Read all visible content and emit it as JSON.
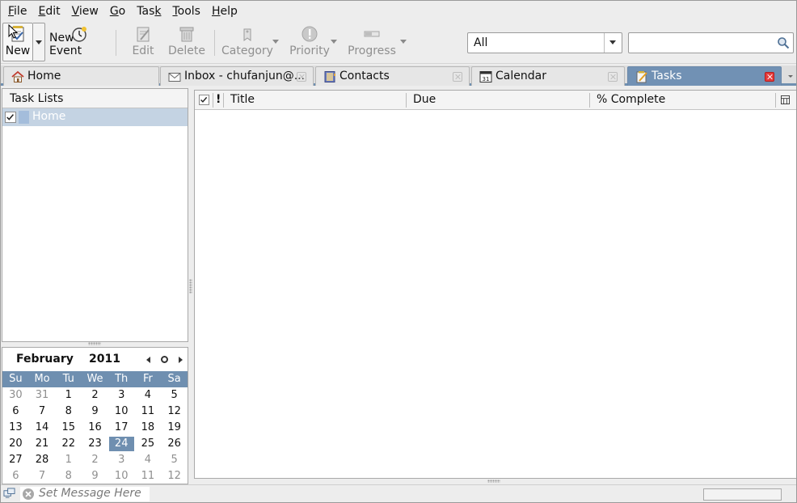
{
  "menubar": {
    "items": [
      {
        "label": "File",
        "accel": "F",
        "rest": "ile"
      },
      {
        "label": "Edit",
        "accel": "E",
        "rest": "dit"
      },
      {
        "label": "View",
        "accel": "V",
        "rest": "iew"
      },
      {
        "label": "Go",
        "accel": "G",
        "rest": "o"
      },
      {
        "label": "Task",
        "pre": "Tas",
        "accel": "k",
        "rest": ""
      },
      {
        "label": "Tools",
        "accel": "T",
        "rest": "ools"
      },
      {
        "label": "Help",
        "accel": "H",
        "rest": "elp"
      }
    ]
  },
  "toolbar": {
    "new_label": "New",
    "new_event_label": "New Event",
    "edit_label": "Edit",
    "delete_label": "Delete",
    "category_label": "Category",
    "priority_label": "Priority",
    "progress_label": "Progress",
    "filter_value": "All",
    "search_value": ""
  },
  "tabs": [
    {
      "label": "Home",
      "icon": "home-icon"
    },
    {
      "label": "Inbox - chufanjun@...",
      "icon": "envelope-icon"
    },
    {
      "label": "Contacts",
      "icon": "address-book-icon"
    },
    {
      "label": "Calendar",
      "icon": "calendar-icon",
      "icon_text": "31"
    },
    {
      "label": "Tasks",
      "icon": "tasks-icon",
      "active": true
    }
  ],
  "task_lists": {
    "header": "Task Lists",
    "items": [
      {
        "name": "Home",
        "checked": true
      }
    ]
  },
  "minical": {
    "month": "February",
    "year": "2011",
    "weekdays": [
      "Su",
      "Mo",
      "Tu",
      "We",
      "Th",
      "Fr",
      "Sa"
    ],
    "days": [
      {
        "d": "30",
        "other": true
      },
      {
        "d": "31",
        "other": true
      },
      {
        "d": "1"
      },
      {
        "d": "2"
      },
      {
        "d": "3"
      },
      {
        "d": "4"
      },
      {
        "d": "5"
      },
      {
        "d": "6"
      },
      {
        "d": "7"
      },
      {
        "d": "8"
      },
      {
        "d": "9"
      },
      {
        "d": "10"
      },
      {
        "d": "11"
      },
      {
        "d": "12"
      },
      {
        "d": "13"
      },
      {
        "d": "14"
      },
      {
        "d": "15"
      },
      {
        "d": "16"
      },
      {
        "d": "17"
      },
      {
        "d": "18"
      },
      {
        "d": "19"
      },
      {
        "d": "20"
      },
      {
        "d": "21"
      },
      {
        "d": "22"
      },
      {
        "d": "23"
      },
      {
        "d": "24",
        "today": true
      },
      {
        "d": "25"
      },
      {
        "d": "26"
      },
      {
        "d": "27"
      },
      {
        "d": "28"
      },
      {
        "d": "1",
        "other": true
      },
      {
        "d": "2",
        "other": true
      },
      {
        "d": "3",
        "other": true
      },
      {
        "d": "4",
        "other": true
      },
      {
        "d": "5",
        "other": true
      },
      {
        "d": "6",
        "other": true
      },
      {
        "d": "7",
        "other": true
      },
      {
        "d": "8",
        "other": true
      },
      {
        "d": "9",
        "other": true
      },
      {
        "d": "10",
        "other": true
      },
      {
        "d": "11",
        "other": true
      },
      {
        "d": "12",
        "other": true
      }
    ]
  },
  "task_table": {
    "columns": {
      "priority": "!",
      "title": "Title",
      "due": "Due",
      "complete": "% Complete"
    },
    "rows": []
  },
  "statusbar": {
    "message_placeholder": "Set Message Here"
  },
  "colors": {
    "accent": "#6f8fb0",
    "active_tab": "#7191b4",
    "close_red": "#e53b3b",
    "selection": "#c4d3e3"
  }
}
